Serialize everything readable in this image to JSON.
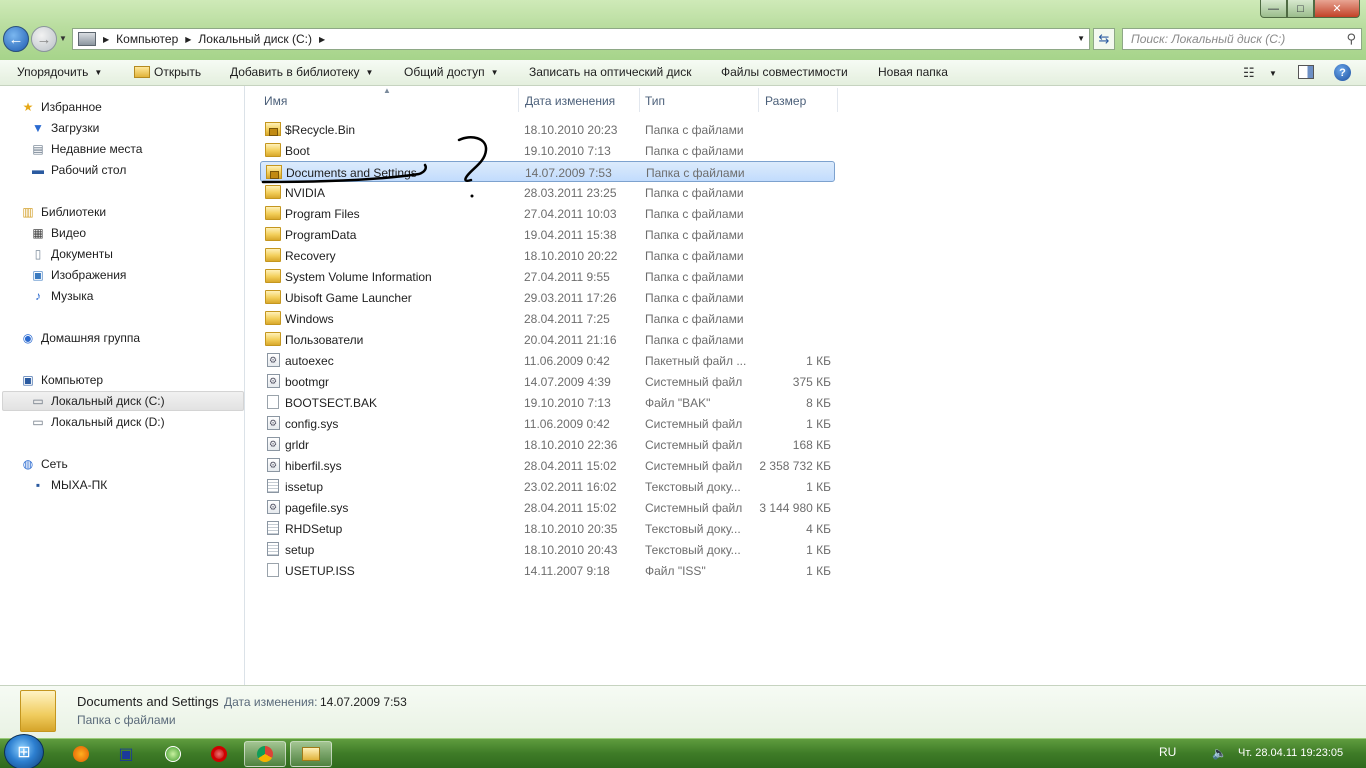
{
  "window": {
    "controls": {
      "minimize": "—",
      "maximize": "□",
      "close": "✕"
    },
    "address": {
      "crumbs": [
        "Компьютер",
        "Локальный диск (C:)"
      ]
    },
    "search": {
      "placeholder": "Поиск: Локальный диск (C:)"
    }
  },
  "toolbar": {
    "organize": "Упорядочить",
    "open": "Открыть",
    "add_to_library": "Добавить в библиотеку",
    "share": "Общий доступ",
    "burn": "Записать на оптический диск",
    "compat_files": "Файлы совместимости",
    "new_folder": "Новая папка"
  },
  "nav": {
    "favorites": {
      "label": "Избранное",
      "items": [
        "Загрузки",
        "Недавние места",
        "Рабочий стол"
      ]
    },
    "libraries": {
      "label": "Библиотеки",
      "items": [
        "Видео",
        "Документы",
        "Изображения",
        "Музыка"
      ]
    },
    "homegroup": {
      "label": "Домашняя группа"
    },
    "computer": {
      "label": "Компьютер",
      "items": [
        "Локальный диск (C:)",
        "Локальный диск (D:)"
      ],
      "selected": "Локальный диск (C:)"
    },
    "network": {
      "label": "Сеть",
      "items": [
        "МЫХА-ПК"
      ]
    }
  },
  "columns": {
    "name": "Имя",
    "date": "Дата изменения",
    "type": "Тип",
    "size": "Размер"
  },
  "files": [
    {
      "name": "$Recycle.Bin",
      "date": "18.10.2010 20:23",
      "type": "Папка с файлами",
      "size": "",
      "icon": "locked-folder-icon"
    },
    {
      "name": "Boot",
      "date": "19.10.2010 7:13",
      "type": "Папка с файлами",
      "size": "",
      "icon": "folder-icon"
    },
    {
      "name": "Documents and Settings",
      "date": "14.07.2009 7:53",
      "type": "Папка с файлами",
      "size": "",
      "icon": "locked-folder-icon",
      "selected": true
    },
    {
      "name": "NVIDIA",
      "date": "28.03.2011 23:25",
      "type": "Папка с файлами",
      "size": "",
      "icon": "folder-icon"
    },
    {
      "name": "Program Files",
      "date": "27.04.2011 10:03",
      "type": "Папка с файлами",
      "size": "",
      "icon": "folder-icon"
    },
    {
      "name": "ProgramData",
      "date": "19.04.2011 15:38",
      "type": "Папка с файлами",
      "size": "",
      "icon": "folder-icon"
    },
    {
      "name": "Recovery",
      "date": "18.10.2010 20:22",
      "type": "Папка с файлами",
      "size": "",
      "icon": "folder-icon"
    },
    {
      "name": "System Volume Information",
      "date": "27.04.2011 9:55",
      "type": "Папка с файлами",
      "size": "",
      "icon": "folder-icon"
    },
    {
      "name": "Ubisoft Game Launcher",
      "date": "29.03.2011 17:26",
      "type": "Папка с файлами",
      "size": "",
      "icon": "folder-icon"
    },
    {
      "name": "Windows",
      "date": "28.04.2011 7:25",
      "type": "Папка с файлами",
      "size": "",
      "icon": "folder-icon"
    },
    {
      "name": "Пользователи",
      "date": "20.04.2011 21:16",
      "type": "Папка с файлами",
      "size": "",
      "icon": "folder-icon"
    },
    {
      "name": "autoexec",
      "date": "11.06.2009 0:42",
      "type": "Пакетный файл ...",
      "size": "1 КБ",
      "icon": "sys-file-icon"
    },
    {
      "name": "bootmgr",
      "date": "14.07.2009 4:39",
      "type": "Системный файл",
      "size": "375 КБ",
      "icon": "sys-file-icon"
    },
    {
      "name": "BOOTSECT.BAK",
      "date": "19.10.2010 7:13",
      "type": "Файл \"BAK\"",
      "size": "8 КБ",
      "icon": "file-icon"
    },
    {
      "name": "config.sys",
      "date": "11.06.2009 0:42",
      "type": "Системный файл",
      "size": "1 КБ",
      "icon": "sys-file-icon"
    },
    {
      "name": "grldr",
      "date": "18.10.2010 22:36",
      "type": "Системный файл",
      "size": "168 КБ",
      "icon": "sys-file-icon"
    },
    {
      "name": "hiberfil.sys",
      "date": "28.04.2011 15:02",
      "type": "Системный файл",
      "size": "2 358 732 КБ",
      "icon": "sys-file-icon"
    },
    {
      "name": "issetup",
      "date": "23.02.2011 16:02",
      "type": "Текстовый доку...",
      "size": "1 КБ",
      "icon": "text-file-icon"
    },
    {
      "name": "pagefile.sys",
      "date": "28.04.2011 15:02",
      "type": "Системный файл",
      "size": "3 144 980 КБ",
      "icon": "sys-file-icon"
    },
    {
      "name": "RHDSetup",
      "date": "18.10.2010 20:35",
      "type": "Текстовый доку...",
      "size": "4 КБ",
      "icon": "text-file-icon"
    },
    {
      "name": "setup",
      "date": "18.10.2010 20:43",
      "type": "Текстовый доку...",
      "size": "1 КБ",
      "icon": "text-file-icon"
    },
    {
      "name": "USETUP.ISS",
      "date": "14.11.2007 9:18",
      "type": "Файл \"ISS\"",
      "size": "1 КБ",
      "icon": "file-icon"
    }
  ],
  "details": {
    "name": "Documents and Settings",
    "date_label": "Дата изменения:",
    "date_value": "14.07.2009 7:53",
    "type": "Папка с файлами"
  },
  "taskbar": {
    "apps": [
      "avast-icon",
      "save-icon",
      "utorrent-icon",
      "opera-icon",
      "chrome-icon",
      "explorer-icon"
    ],
    "active_app": "explorer-icon",
    "lang": "RU",
    "clock": "Чт. 28.04.11 19:23:05"
  },
  "colors": {
    "selection": "#c2dcfd",
    "selection_border": "#7da2ce",
    "annotation_ink": "#000000"
  }
}
